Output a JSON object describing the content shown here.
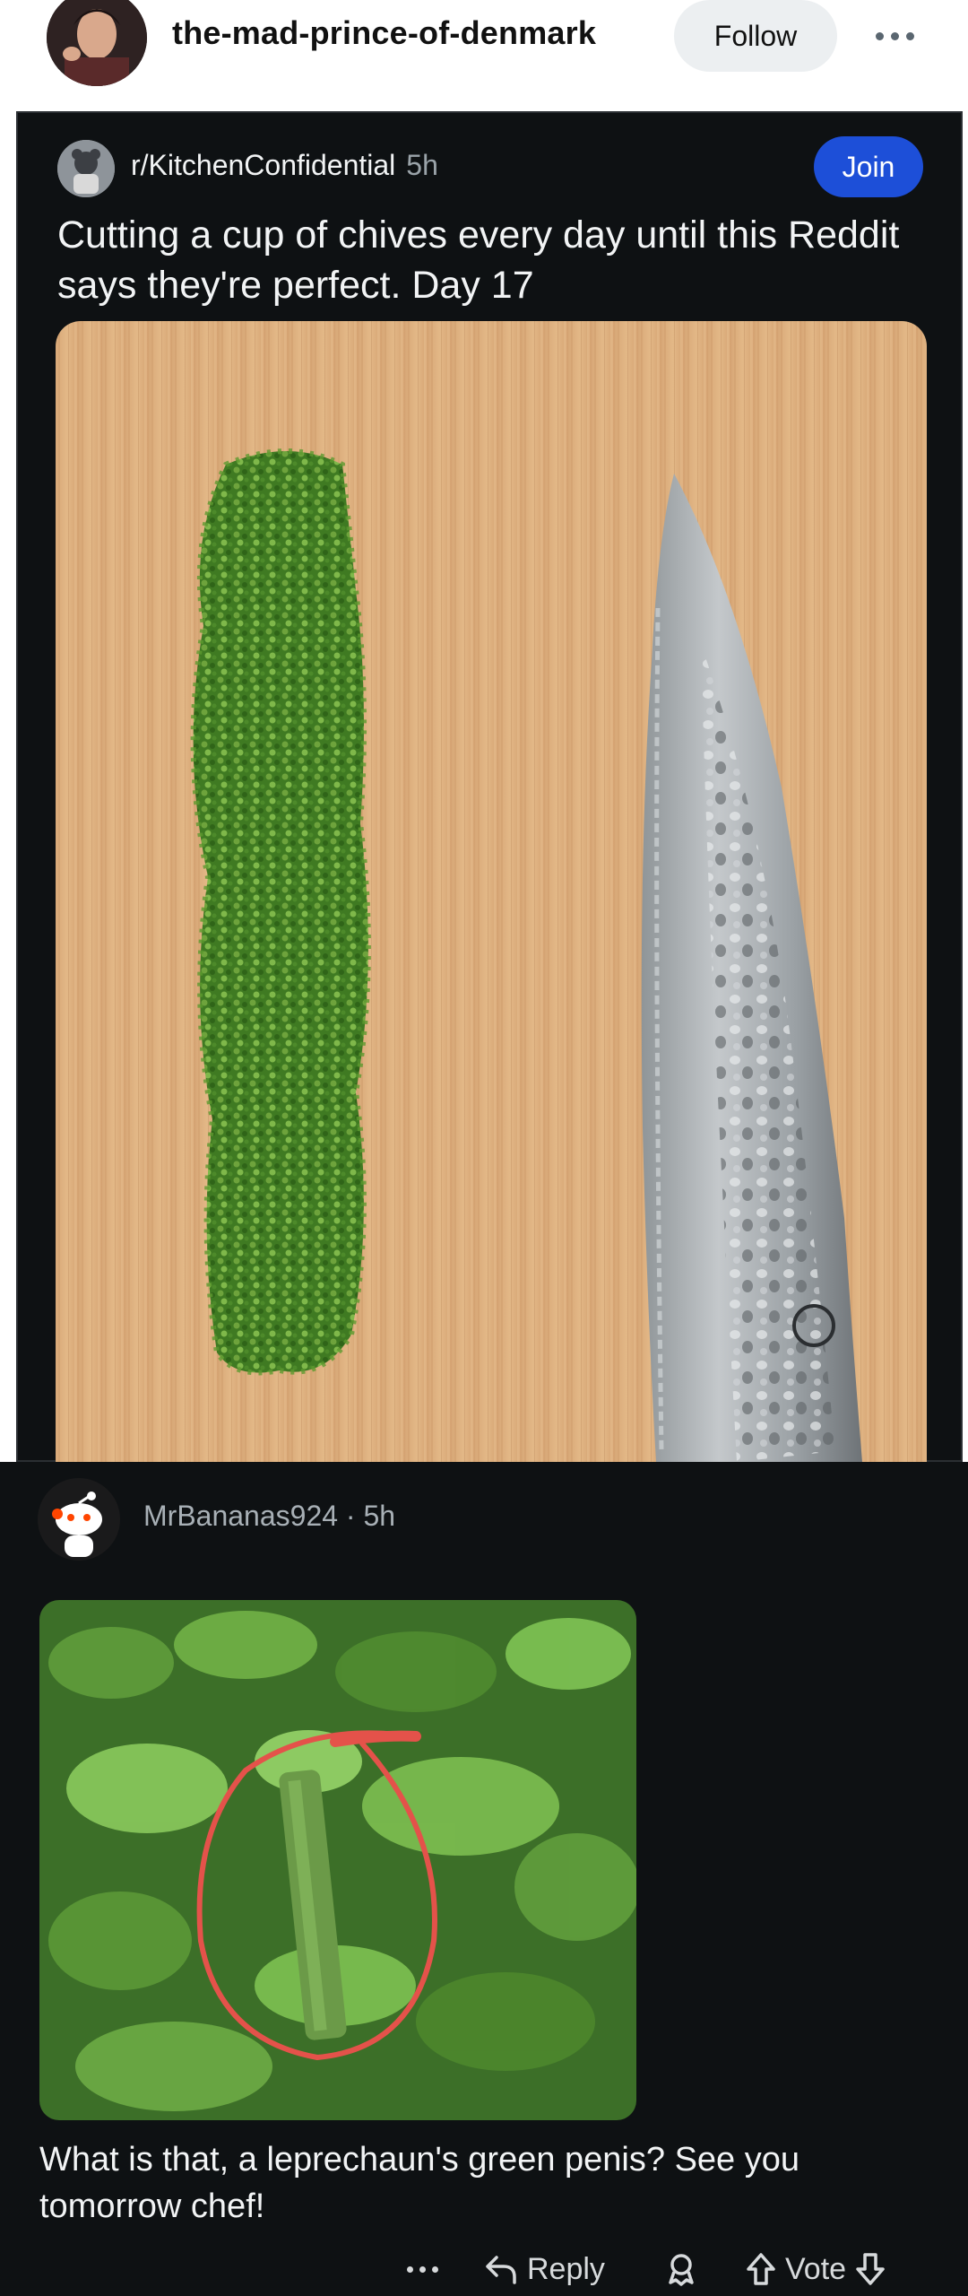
{
  "header": {
    "username": "the-mad-prince-of-denmark",
    "follow_label": "Follow",
    "more_icon": "ellipsis-icon"
  },
  "post": {
    "subreddit": "r/KitchenConfidential",
    "time": "5h",
    "join_label": "Join",
    "title": "Cutting a cup of chives every day until this Reddit says they're perfect. Day 17",
    "image_icon": "chives-and-knife-photo"
  },
  "comment": {
    "author": "MrBananas924",
    "separator": "·",
    "time": "5h",
    "image_icon": "chives-closeup-photo",
    "text": "What is that, a leprechaun's green penis? See you tomorrow chef!",
    "actions": {
      "reply_label": "Reply",
      "vote_label": "Vote"
    }
  },
  "colors": {
    "dark_bg": "#0e1113",
    "join_blue": "#1d4fd8",
    "circle_red": "#e4524a"
  }
}
